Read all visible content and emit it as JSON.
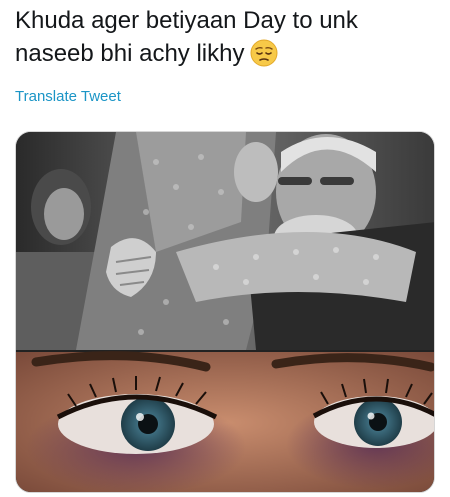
{
  "tweet": {
    "text_line1": "Khuda ager betiyaan Day to unk",
    "text_line2": "naseeb bhi achy likhy",
    "emoji": "pensive-face-emoji",
    "translate_label": "Translate Tweet"
  },
  "colors": {
    "text": "#14171a",
    "link": "#1b95c6",
    "emoji_yellow": "#f7c948"
  },
  "media": {
    "top_photo": "bride-embracing-father-grayscale-photo",
    "bottom_photo": "bruised-eyes-closeup-photo"
  }
}
